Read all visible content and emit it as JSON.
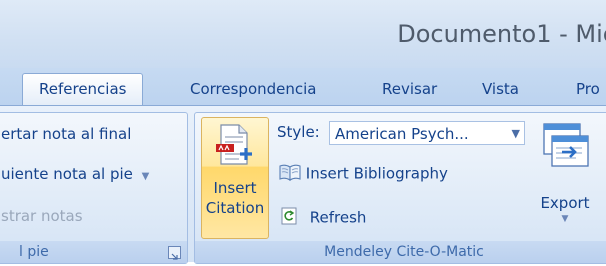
{
  "window": {
    "title": "Documento1 - Mic"
  },
  "tabs": [
    {
      "label": "Referencias",
      "active": true
    },
    {
      "label": "Correspondencia",
      "active": false
    },
    {
      "label": "Revisar",
      "active": false
    },
    {
      "label": "Vista",
      "active": false
    },
    {
      "label": "Pro",
      "active": false
    }
  ],
  "footnotes_group": {
    "items": [
      {
        "label": "ertar nota al final",
        "enabled": true
      },
      {
        "label": "uiente nota al pie",
        "enabled": true,
        "has_dropdown": true
      },
      {
        "label": "strar notas",
        "enabled": false
      }
    ],
    "group_label": "l pie"
  },
  "mendeley_group": {
    "insert_citation_line1": "Insert",
    "insert_citation_line2": "Citation",
    "style_label": "Style:",
    "style_value": "American Psych...",
    "insert_bibliography": "Insert Bibliography",
    "refresh": "Refresh",
    "export": "Export",
    "group_label": "Mendeley Cite-O-Matic"
  },
  "colors": {
    "accent_text": "#15428b",
    "highlight_button": "#ffd86b",
    "ribbon_bg": "#dfeaf8"
  }
}
